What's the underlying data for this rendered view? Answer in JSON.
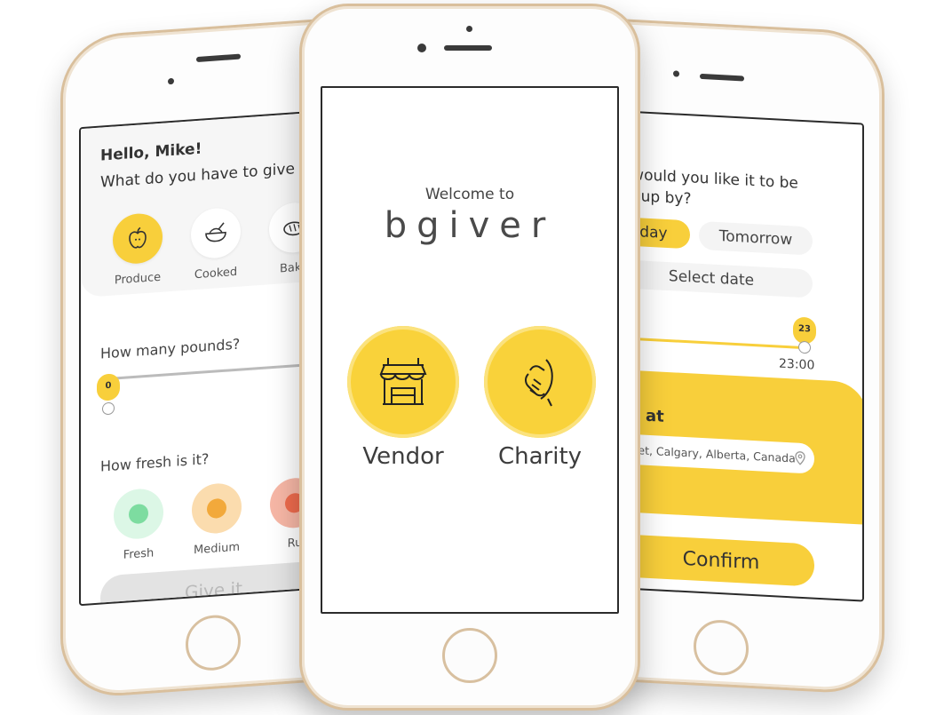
{
  "left_screen": {
    "greeting": "Hello, Mike!",
    "question": "What do you have to give",
    "categories": [
      {
        "label": "Produce",
        "icon": "apple-icon",
        "selected": true
      },
      {
        "label": "Cooked",
        "icon": "bowl-icon",
        "selected": false
      },
      {
        "label": "Bake",
        "icon": "bread-icon",
        "selected": false
      }
    ],
    "pounds_question": "How many pounds?",
    "pounds_value": "0",
    "fresh_question": "How fresh is it?",
    "freshness": [
      {
        "label": "Fresh",
        "color": "#7ddca0"
      },
      {
        "label": "Medium",
        "color": "#f2a93b"
      },
      {
        "label": "Ru",
        "color": "#ee6b4d"
      }
    ],
    "give_button": "Give it"
  },
  "middle_screen": {
    "welcome": "Welcome to",
    "brand": "bgiver",
    "roles": [
      {
        "label": "Vendor",
        "icon": "storefront-icon"
      },
      {
        "label": "Charity",
        "icon": "handshake-icon"
      }
    ],
    "accent": "#f9d23a"
  },
  "right_screen": {
    "question_line1": "n would you like it to be",
    "question_line2": "ed up by?",
    "today": "Today",
    "tomorrow": "Tomorrow",
    "select_date": "Select date",
    "hour_value": "23",
    "time": "23:00",
    "pickup_label": "up at",
    "address": "Street, Calgary, Alberta, Canada",
    "confirm": "Confirm"
  }
}
